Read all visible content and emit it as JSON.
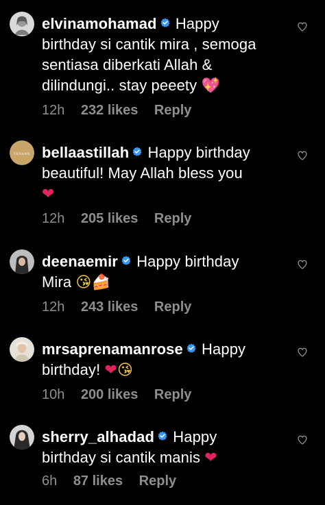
{
  "comments": [
    {
      "username": "elvinamohamad",
      "verified": true,
      "text_lines": [
        "Happy",
        "birthday si cantik mira , semoga",
        "sentiasa diberkati Allah &",
        "dilindungi.. stay peeety"
      ],
      "emojis": [
        "💖"
      ],
      "time": "12h",
      "likes": "232 likes",
      "reply": "Reply"
    },
    {
      "username": "bellaastillah",
      "verified": true,
      "text_lines": [
        "Happy birthday",
        "beautiful! May Allah bless you"
      ],
      "emojis": [
        "❤"
      ],
      "avatar_text": "TENANG",
      "time": "12h",
      "likes": "205 likes",
      "reply": "Reply"
    },
    {
      "username": "deenaemir",
      "verified": true,
      "text_lines": [
        "Happy birthday",
        "Mira"
      ],
      "emojis": [
        "😘",
        "🍰"
      ],
      "time": "12h",
      "likes": "243 likes",
      "reply": "Reply"
    },
    {
      "username": "mrsaprenamanrose",
      "verified": true,
      "text_lines": [
        "Happy",
        "birthday!"
      ],
      "emojis": [
        "❤",
        "😘"
      ],
      "time": "10h",
      "likes": "200 likes",
      "reply": "Reply"
    },
    {
      "username": "sherry_alhadad",
      "verified": true,
      "text_lines": [
        "Happy",
        "birthday si cantik manis"
      ],
      "emojis": [
        "❤"
      ],
      "time": "6h",
      "likes": "87 likes",
      "reply": "Reply"
    }
  ],
  "colors": {
    "background": "#000000",
    "text": "#ffffff",
    "secondary": "#8e8e8e",
    "verified_badge": "#3897f0",
    "heart": "#e0245e"
  },
  "icons": {
    "verified": "verified-badge-icon",
    "like": "heart-outline-icon"
  }
}
